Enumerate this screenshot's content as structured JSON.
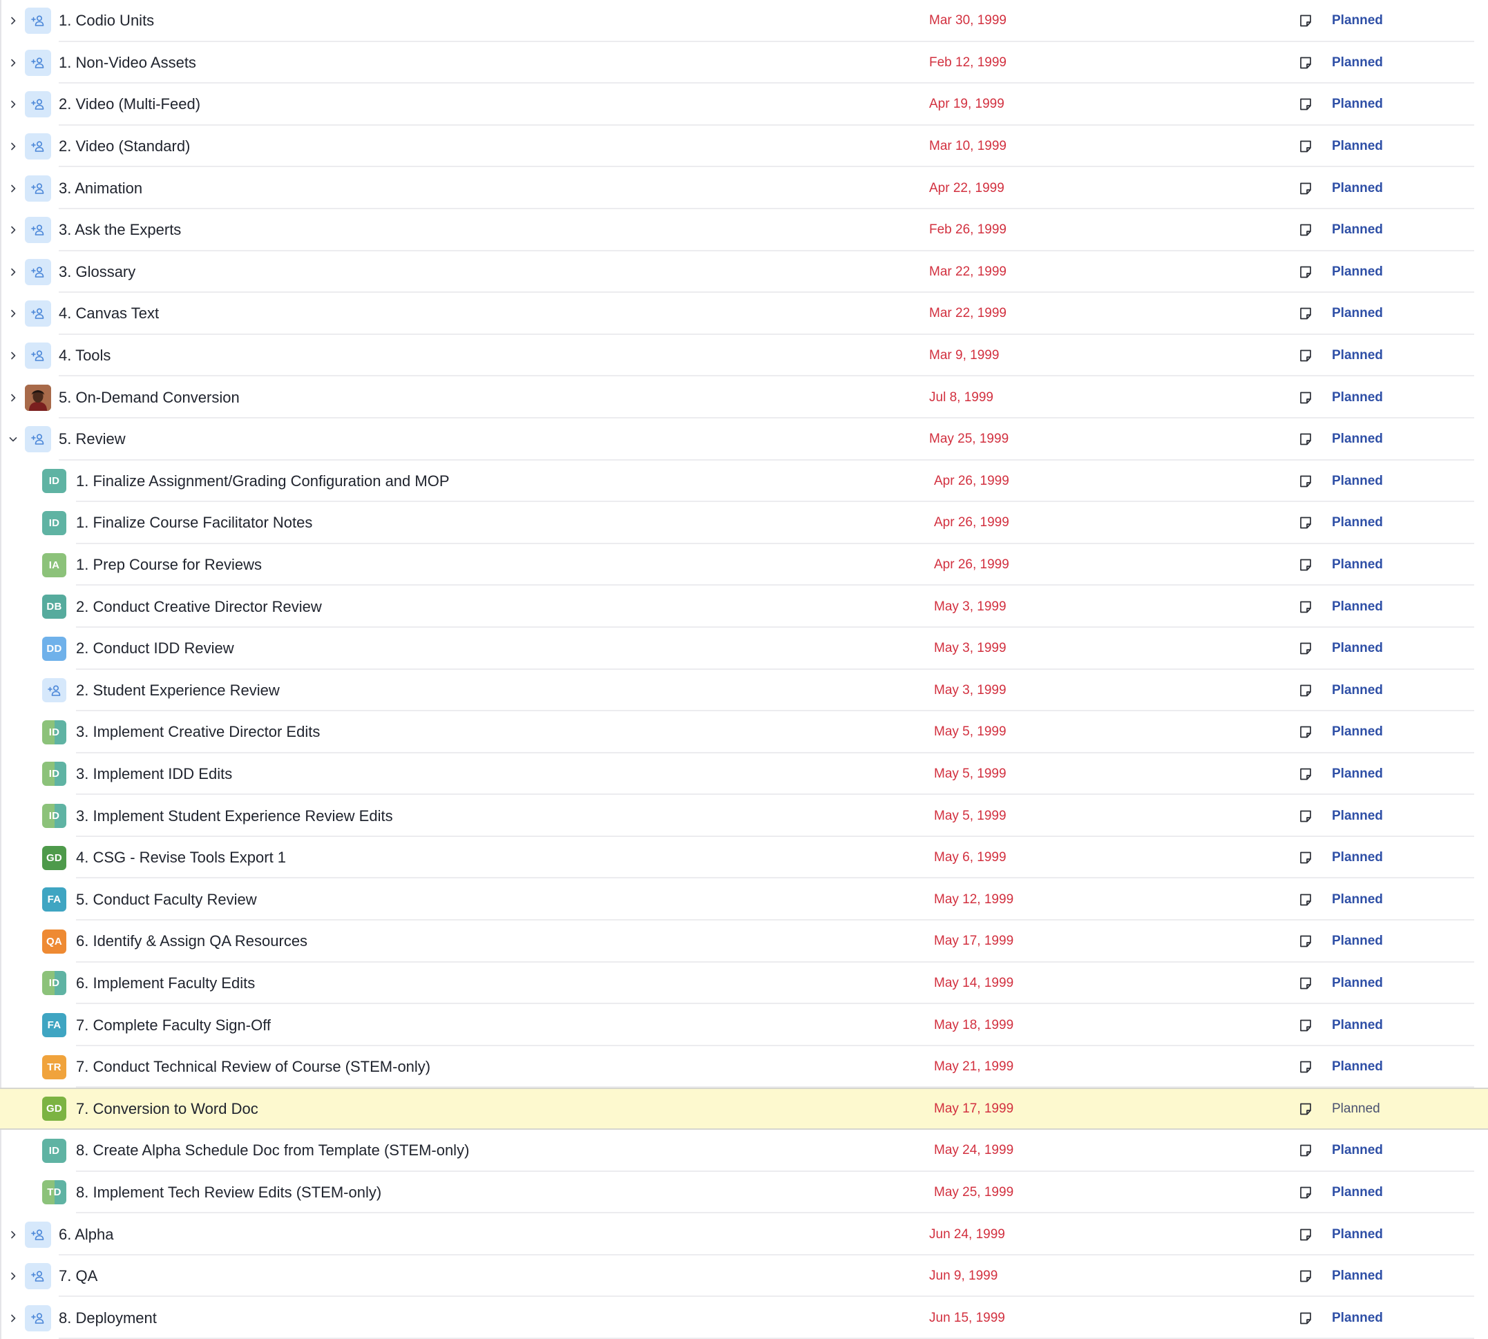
{
  "rows": [
    {
      "name": "1. Codio Units",
      "date": "Mar 30, 1999",
      "status": "Planned",
      "level": 0,
      "expanded": false,
      "avatar": {
        "type": "assign"
      }
    },
    {
      "name": "1. Non-Video Assets",
      "date": "Feb 12, 1999",
      "status": "Planned",
      "level": 0,
      "expanded": false,
      "avatar": {
        "type": "assign"
      }
    },
    {
      "name": "2. Video (Multi-Feed)",
      "date": "Apr 19, 1999",
      "status": "Planned",
      "level": 0,
      "expanded": false,
      "avatar": {
        "type": "assign"
      }
    },
    {
      "name": "2. Video (Standard)",
      "date": "Mar 10, 1999",
      "status": "Planned",
      "level": 0,
      "expanded": false,
      "avatar": {
        "type": "assign"
      }
    },
    {
      "name": "3. Animation",
      "date": "Apr 22, 1999",
      "status": "Planned",
      "level": 0,
      "expanded": false,
      "avatar": {
        "type": "assign"
      }
    },
    {
      "name": "3. Ask the Experts",
      "date": "Feb 26, 1999",
      "status": "Planned",
      "level": 0,
      "expanded": false,
      "avatar": {
        "type": "assign"
      }
    },
    {
      "name": "3. Glossary",
      "date": "Mar 22, 1999",
      "status": "Planned",
      "level": 0,
      "expanded": false,
      "avatar": {
        "type": "assign"
      }
    },
    {
      "name": "4. Canvas Text",
      "date": "Mar 22, 1999",
      "status": "Planned",
      "level": 0,
      "expanded": false,
      "avatar": {
        "type": "assign"
      }
    },
    {
      "name": "4. Tools",
      "date": "Mar 9, 1999",
      "status": "Planned",
      "level": 0,
      "expanded": false,
      "avatar": {
        "type": "assign"
      }
    },
    {
      "name": "5. On-Demand Conversion",
      "date": "Jul 8, 1999",
      "status": "Planned",
      "level": 0,
      "expanded": false,
      "avatar": {
        "type": "photo"
      }
    },
    {
      "name": "5. Review",
      "date": "May 25, 1999",
      "status": "Planned",
      "level": 0,
      "expanded": true,
      "avatar": {
        "type": "assign"
      }
    },
    {
      "name": "1. Finalize Assignment/Grading Configuration and MOP",
      "date": "Apr 26, 1999",
      "status": "Planned",
      "level": 1,
      "avatar": {
        "type": "initials",
        "text": "ID",
        "color": "#5fb3a3"
      }
    },
    {
      "name": "1. Finalize Course Facilitator Notes",
      "date": "Apr 26, 1999",
      "status": "Planned",
      "level": 1,
      "avatar": {
        "type": "initials",
        "text": "ID",
        "color": "#5fb3a3"
      }
    },
    {
      "name": "1. Prep Course for Reviews",
      "date": "Apr 26, 1999",
      "status": "Planned",
      "level": 1,
      "avatar": {
        "type": "initials",
        "text": "IA",
        "color": "#8cc27a"
      }
    },
    {
      "name": "2. Conduct Creative Director Review",
      "date": "May 3, 1999",
      "status": "Planned",
      "level": 1,
      "avatar": {
        "type": "initials",
        "text": "DB",
        "color": "#56ab9d"
      }
    },
    {
      "name": "2. Conduct IDD Review",
      "date": "May 3, 1999",
      "status": "Planned",
      "level": 1,
      "avatar": {
        "type": "initials",
        "text": "DD",
        "color": "#6fb1ea"
      }
    },
    {
      "name": "2. Student Experience Review",
      "date": "May 3, 1999",
      "status": "Planned",
      "level": 1,
      "avatar": {
        "type": "assign"
      }
    },
    {
      "name": "3. Implement Creative Director Edits",
      "date": "May 5, 1999",
      "status": "Planned",
      "level": 1,
      "avatar": {
        "type": "split",
        "text": "ID",
        "color": "#8cc27a",
        "color2": "#5fb3a3"
      }
    },
    {
      "name": "3. Implement IDD Edits",
      "date": "May 5, 1999",
      "status": "Planned",
      "level": 1,
      "avatar": {
        "type": "split",
        "text": "ID",
        "color": "#8cc27a",
        "color2": "#5fb3a3"
      }
    },
    {
      "name": "3. Implement Student Experience Review Edits",
      "date": "May 5, 1999",
      "status": "Planned",
      "level": 1,
      "avatar": {
        "type": "split",
        "text": "ID",
        "color": "#8cc27a",
        "color2": "#5fb3a3"
      }
    },
    {
      "name": "4. CSG - Revise Tools Export 1",
      "date": "May 6, 1999",
      "status": "Planned",
      "level": 1,
      "avatar": {
        "type": "initials",
        "text": "GD",
        "color": "#4e9a4b"
      }
    },
    {
      "name": "5. Conduct Faculty Review",
      "date": "May 12, 1999",
      "status": "Planned",
      "level": 1,
      "avatar": {
        "type": "initials",
        "text": "FA",
        "color": "#3fa5c2"
      }
    },
    {
      "name": "6. Identify & Assign QA Resources",
      "date": "May 17, 1999",
      "status": "Planned",
      "level": 1,
      "avatar": {
        "type": "initials",
        "text": "QA",
        "color": "#ee8a33"
      }
    },
    {
      "name": "6. Implement Faculty Edits",
      "date": "May 14, 1999",
      "status": "Planned",
      "level": 1,
      "avatar": {
        "type": "split",
        "text": "ID",
        "color": "#8cc27a",
        "color2": "#5fb3a3"
      }
    },
    {
      "name": "7. Complete Faculty Sign-Off",
      "date": "May 18, 1999",
      "status": "Planned",
      "level": 1,
      "avatar": {
        "type": "initials",
        "text": "FA",
        "color": "#3fa5c2"
      }
    },
    {
      "name": "7. Conduct Technical Review of Course (STEM-only)",
      "date": "May 21, 1999",
      "status": "Planned",
      "level": 1,
      "avatar": {
        "type": "initials",
        "text": "TR",
        "color": "#f0a33c"
      }
    },
    {
      "name": "7. Conversion to Word Doc",
      "date": "May 17, 1999",
      "status": "Planned",
      "level": 1,
      "highlight": true,
      "avatar": {
        "type": "initials",
        "text": "GD",
        "color": "#7cb342"
      }
    },
    {
      "name": "8. Create Alpha Schedule Doc from Template (STEM-only)",
      "date": "May 24, 1999",
      "status": "Planned",
      "level": 1,
      "avatar": {
        "type": "initials",
        "text": "ID",
        "color": "#5fb3a3"
      }
    },
    {
      "name": "8. Implement Tech Review Edits (STEM-only)",
      "date": "May 25, 1999",
      "status": "Planned",
      "level": 1,
      "avatar": {
        "type": "split",
        "text": "TD",
        "color": "#8cc27a",
        "color2": "#5fb3a3"
      }
    },
    {
      "name": "6. Alpha",
      "date": "Jun 24, 1999",
      "status": "Planned",
      "level": 0,
      "expanded": false,
      "avatar": {
        "type": "assign"
      }
    },
    {
      "name": "7. QA",
      "date": "Jun 9, 1999",
      "status": "Planned",
      "level": 0,
      "expanded": false,
      "avatar": {
        "type": "assign"
      }
    },
    {
      "name": "8. Deployment",
      "date": "Jun 15, 1999",
      "status": "Planned",
      "level": 0,
      "expanded": false,
      "avatar": {
        "type": "assign"
      }
    }
  ],
  "icons": {
    "expand": "chevron-right-icon",
    "collapse": "chevron-down-icon",
    "assign": "add-user-icon",
    "note": "note-icon"
  },
  "colors": {
    "date": "#d2303f",
    "status": "#2e4fa6",
    "highlight": "#fdf9cf",
    "assign_bg": "#d6e8fb",
    "assign_fg": "#4a86d8"
  }
}
